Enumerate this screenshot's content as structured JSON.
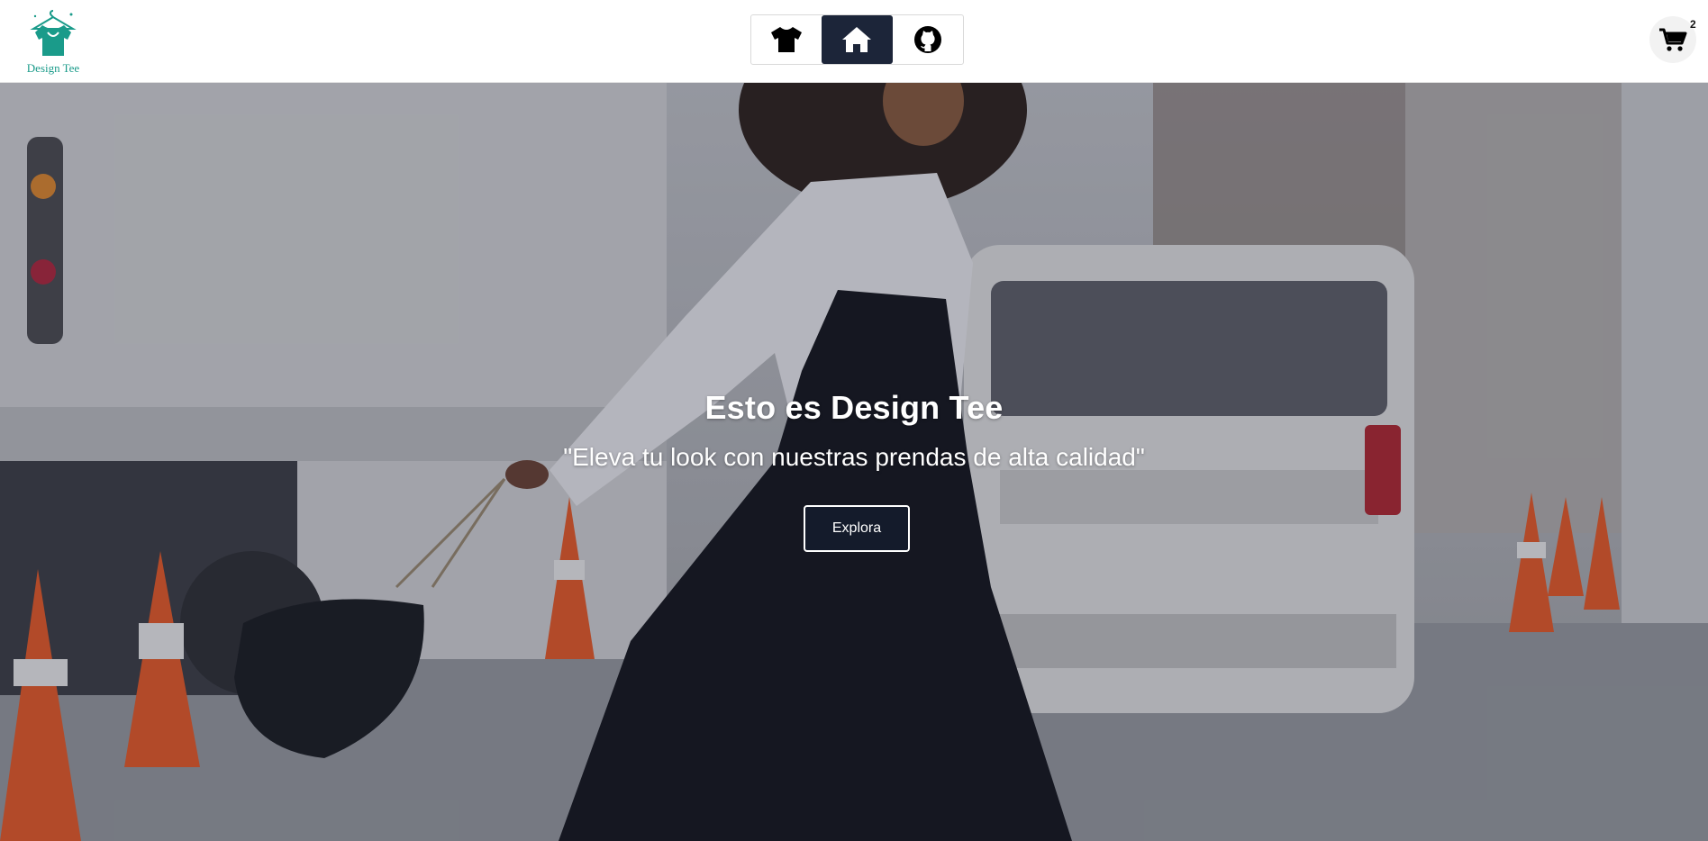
{
  "brand": {
    "name": "Design Tee",
    "color": "#1a9b8a"
  },
  "nav": {
    "items": [
      {
        "icon": "tshirt-icon",
        "active": false
      },
      {
        "icon": "home-icon",
        "active": true
      },
      {
        "icon": "github-icon",
        "active": false
      }
    ],
    "active_color": "#1c2539"
  },
  "cart": {
    "icon": "cart-icon",
    "count": "2"
  },
  "hero": {
    "title": "Esto es Design Tee",
    "subtitle": "\"Eleva tu look con nuestras prendas de alta calidad\"",
    "button_label": "Explora"
  }
}
